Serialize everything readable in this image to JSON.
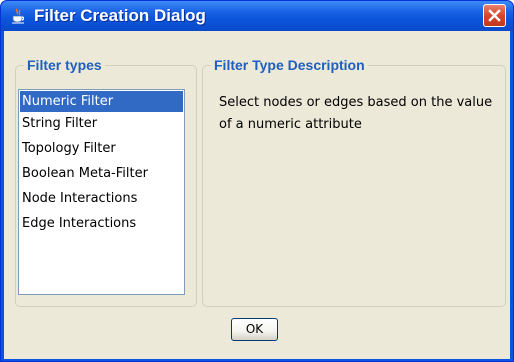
{
  "window": {
    "title": "Filter Creation Dialog",
    "icon": "java-coffee-cup-icon",
    "close_icon": "close-icon",
    "colors": {
      "titlebar": "#0b55db",
      "close": "#d6472b",
      "client": "#ece9d8",
      "group_label": "#1f5fc0",
      "selection": "#316ac5"
    }
  },
  "filter_types": {
    "label": "Filter types",
    "items": [
      {
        "label": "Numeric Filter",
        "selected": true
      },
      {
        "label": "String Filter",
        "selected": false
      },
      {
        "label": "Topology Filter",
        "selected": false
      },
      {
        "label": "Boolean Meta-Filter",
        "selected": false
      },
      {
        "label": "Node Interactions",
        "selected": false
      },
      {
        "label": "Edge Interactions",
        "selected": false
      }
    ]
  },
  "description": {
    "label": "Filter Type Description",
    "text": "Select nodes or edges based on the value of a numeric attribute"
  },
  "buttons": {
    "ok": "OK"
  }
}
